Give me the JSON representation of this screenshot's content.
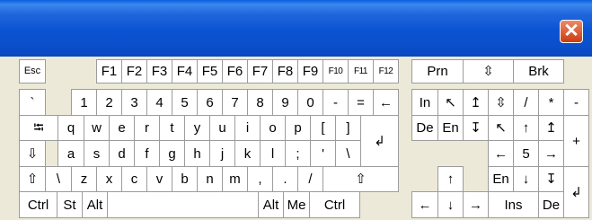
{
  "window": {
    "close_glyph": "✕"
  },
  "keys": {
    "esc": "Esc",
    "f1": "F1",
    "f2": "F2",
    "f3": "F3",
    "f4": "F4",
    "f5": "F5",
    "f6": "F6",
    "f7": "F7",
    "f8": "F8",
    "f9": "F9",
    "f10": "F10",
    "f11": "F11",
    "f12": "F12",
    "prn": "Prn",
    "scroll": "⇳",
    "brk": "Brk",
    "backtick": "`",
    "n1": "1",
    "n2": "2",
    "n3": "3",
    "n4": "4",
    "n5": "5",
    "n6": "6",
    "n7": "7",
    "n8": "8",
    "n9": "9",
    "n0": "0",
    "minus": "-",
    "equals": "=",
    "backspace": "←",
    "ins": "In",
    "home": "↖",
    "pgup": "↥",
    "numlock": "⇳",
    "np_div": "/",
    "np_mul": "*",
    "np_sub": "-",
    "tab": "⭾",
    "q": "q",
    "w": "w",
    "e": "e",
    "r": "r",
    "t": "t",
    "y": "y",
    "u": "u",
    "i": "i",
    "o": "o",
    "p": "p",
    "lbracket": "[",
    "rbracket": "]",
    "enter": "↲",
    "del": "De",
    "end": "En",
    "pgdn": "↧",
    "np7": "↖",
    "np8": "↑",
    "np9": "↥",
    "np_add": "+",
    "caps": "⇩",
    "a": "a",
    "s": "s",
    "d": "d",
    "f": "f",
    "g": "g",
    "h": "h",
    "j": "j",
    "k": "k",
    "l": "l",
    "semicolon": ";",
    "quote": "'",
    "backslash": "\\",
    "np4": "←",
    "np5": "5",
    "np6": "→",
    "lshift": "⇧",
    "backslash2": "\\",
    "z": "z",
    "x": "x",
    "c": "c",
    "v": "v",
    "b": "b",
    "n": "n",
    "m": "m",
    "comma": ",",
    "period": ".",
    "slash": "/",
    "rshift": "⇧",
    "up": "↑",
    "np1": "En",
    "np2": "↓",
    "np3": "↧",
    "np_enter": "↲",
    "lctrl": "Ctrl",
    "lwin": "St",
    "lalt": "Alt",
    "space": "",
    "ralt": "Alt",
    "menu": "Me",
    "rctrl": "Ctrl",
    "left": "←",
    "down": "↓",
    "right": "→",
    "np0": "Ins",
    "np_dec": "De"
  }
}
